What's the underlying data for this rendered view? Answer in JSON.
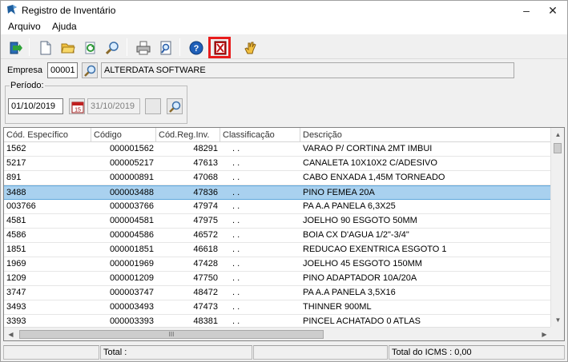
{
  "window": {
    "title": "Registro de Inventário",
    "minimize_icon": "minimize-icon",
    "close_icon": "close-icon"
  },
  "menu": [
    {
      "label": "Arquivo"
    },
    {
      "label": "Ajuda"
    }
  ],
  "toolbar": {
    "buttons": [
      {
        "name": "exit-icon"
      },
      {
        "name": "new-document-icon"
      },
      {
        "name": "open-folder-icon"
      },
      {
        "name": "refresh-icon"
      },
      {
        "name": "search-icon"
      },
      {
        "name": "print-icon"
      },
      {
        "name": "print-preview-icon"
      },
      {
        "name": "help-icon"
      },
      {
        "name": "generate-file-icon",
        "highlighted": true,
        "highlight_color": "#e81c1c"
      },
      {
        "name": "hand-icon"
      }
    ]
  },
  "filters": {
    "empresa_label": "Empresa",
    "empresa_code": "00001",
    "empresa_name": "ALTERDATA SOFTWARE",
    "periodo_label": "Período:",
    "date_from": "01/10/2019",
    "date_to": "31/10/2019"
  },
  "grid": {
    "columns": [
      "Cód. Específico",
      "Código",
      "Cód.Reg.Inv.",
      "Classificação",
      "Descrição"
    ],
    "rows": [
      {
        "especifico": "1562",
        "codigo": "000001562",
        "reginv": "48291",
        "classificacao": ". .",
        "descricao": "VARAO P/ CORTINA 2MT IMBUI"
      },
      {
        "especifico": "5217",
        "codigo": "000005217",
        "reginv": "47613",
        "classificacao": ". .",
        "descricao": "CANALETA 10X10X2 C/ADESIVO"
      },
      {
        "especifico": "891",
        "codigo": "000000891",
        "reginv": "47068",
        "classificacao": ". .",
        "descricao": "CABO ENXADA 1,45M TORNEADO"
      },
      {
        "especifico": "3488",
        "codigo": "000003488",
        "reginv": "47836",
        "classificacao": ". .",
        "descricao": "PINO FEMEA 20A",
        "selected": true
      },
      {
        "especifico": "003766",
        "codigo": "000003766",
        "reginv": "47974",
        "classificacao": ". .",
        "descricao": "PA A.A PANELA 6,3X25"
      },
      {
        "especifico": "4581",
        "codigo": "000004581",
        "reginv": "47975",
        "classificacao": ". .",
        "descricao": "JOELHO 90 ESGOTO 50MM"
      },
      {
        "especifico": "4586",
        "codigo": "000004586",
        "reginv": "46572",
        "classificacao": ". .",
        "descricao": "BOIA CX D'AGUA 1/2\"-3/4\""
      },
      {
        "especifico": "1851",
        "codigo": "000001851",
        "reginv": "46618",
        "classificacao": ". .",
        "descricao": "REDUCAO EXENTRICA ESGOTO 1"
      },
      {
        "especifico": "1969",
        "codigo": "000001969",
        "reginv": "47428",
        "classificacao": ". .",
        "descricao": "JOELHO 45 ESGOTO 150MM"
      },
      {
        "especifico": "1209",
        "codigo": "000001209",
        "reginv": "47750",
        "classificacao": ". .",
        "descricao": "PINO ADAPTADOR 10A/20A"
      },
      {
        "especifico": "3747",
        "codigo": "000003747",
        "reginv": "48472",
        "classificacao": ". .",
        "descricao": "PA A.A PANELA 3,5X16"
      },
      {
        "especifico": "3493",
        "codigo": "000003493",
        "reginv": "47473",
        "classificacao": ". .",
        "descricao": "THINNER 900ML"
      },
      {
        "especifico": "3393",
        "codigo": "000003393",
        "reginv": "48381",
        "classificacao": ". .",
        "descricao": "PINCEL ACHATADO 0 ATLAS"
      }
    ],
    "hscroll_grip": "III"
  },
  "status": {
    "total_label": "Total :",
    "icms_label": "Total do ICMS : 0,00"
  },
  "colors": {
    "selected_row": "#a9d1ef",
    "toolbar_highlight": "#e81c1c"
  }
}
